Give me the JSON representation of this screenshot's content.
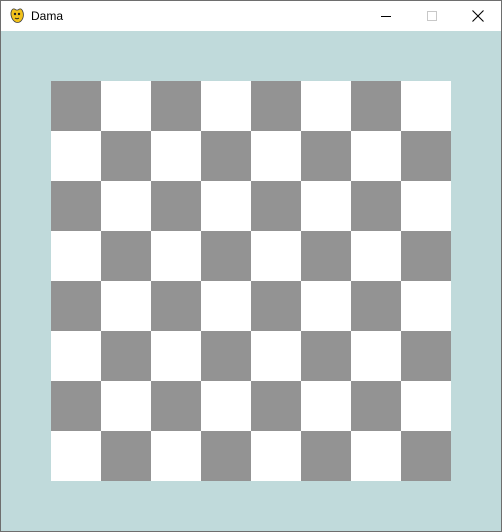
{
  "window": {
    "title": "Dama",
    "app_icon": "pygame-snake-icon",
    "controls": [
      "minimize-icon",
      "maximize-icon",
      "close-icon"
    ]
  },
  "colors": {
    "background": "#c0dadb",
    "dark_square": "#939393",
    "light_square": "#ffffff"
  },
  "board": {
    "rows": 8,
    "cols": 8,
    "top_left": "dark",
    "pieces": []
  }
}
